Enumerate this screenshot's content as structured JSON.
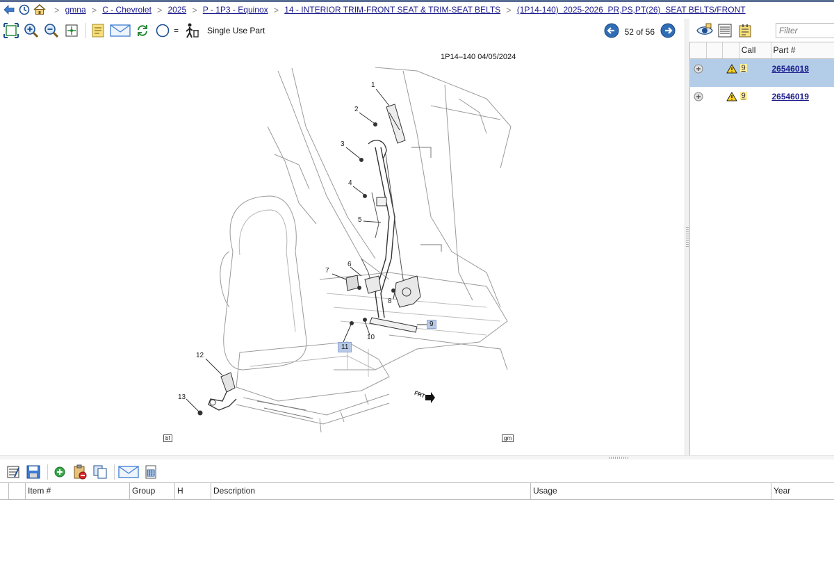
{
  "breadcrumb": {
    "items": [
      {
        "label": "gmna"
      },
      {
        "label": "C - Chevrolet"
      },
      {
        "label": "2025"
      },
      {
        "label": "P - 1P3 - Equinox"
      },
      {
        "label": "14 - INTERIOR TRIM-FRONT SEAT & TRIM-SEAT BELTS"
      },
      {
        "label": "(1P14-140)  2025-2026  PR,PS,PT(26)  SEAT BELTS/FRONT"
      }
    ]
  },
  "toolbar": {
    "equals_label": "=",
    "single_use_label": "Single Use Part",
    "pager": {
      "text": "52 of 56"
    }
  },
  "diagram": {
    "header": "1P14–140  04/05/2024",
    "callouts": [
      "1",
      "2",
      "3",
      "4",
      "5",
      "6",
      "7",
      "8",
      "9",
      "10",
      "11",
      "12",
      "13"
    ],
    "fwd_label": "FRT",
    "corner_left": "bf",
    "corner_right": "gm"
  },
  "right_panel": {
    "filter_placeholder": "Filter",
    "columns": {
      "call": "Call",
      "part": "Part #"
    },
    "rows": [
      {
        "call": "9",
        "part": "26546018",
        "selected": true
      },
      {
        "call": "9",
        "part": "26546019",
        "selected": false
      }
    ]
  },
  "bottom_grid": {
    "columns": {
      "item": "Item #",
      "group": "Group",
      "h": "H",
      "description": "Description",
      "usage": "Usage",
      "year": "Year"
    }
  },
  "colors": {
    "accent": "#2f6db5",
    "selected_row": "#b3cde9",
    "call_badge": "#ffef9a",
    "link": "#1a1a8c",
    "callout_box": "#b7c9e6"
  }
}
